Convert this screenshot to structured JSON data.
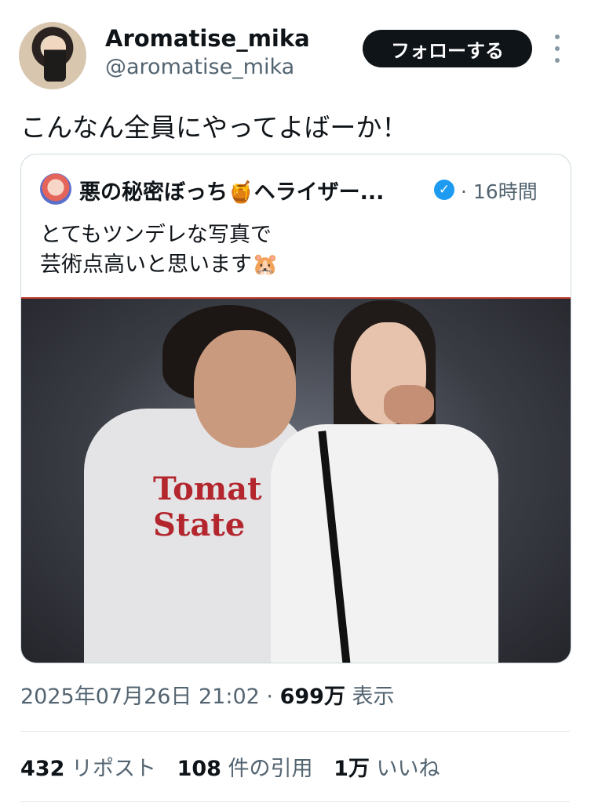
{
  "author": {
    "name": "Aromatise_mika",
    "handle": "@aromatise_mika",
    "follow_label": "フォローする"
  },
  "tweet": {
    "text": "こんなん全員にやってよばーか！"
  },
  "quoted": {
    "name": "悪の秘密ぼっち🍯ヘライザー...",
    "time": "· 16時間",
    "line1": "とてもツンデレな写真で",
    "line2": "芸術点高いと思います🐹",
    "image_shirt_text_1": "Tomat",
    "image_shirt_text_2": "State",
    "verified_mark": "✓"
  },
  "meta": {
    "datetime": "2025年07月26日 21:02 · ",
    "views": "699万",
    "views_label": " 表示"
  },
  "stats": {
    "reposts": "432",
    "reposts_label": " リポスト",
    "quotes": "108",
    "quotes_label": " 件の引用",
    "likes": "1万",
    "likes_label": " いいね"
  }
}
